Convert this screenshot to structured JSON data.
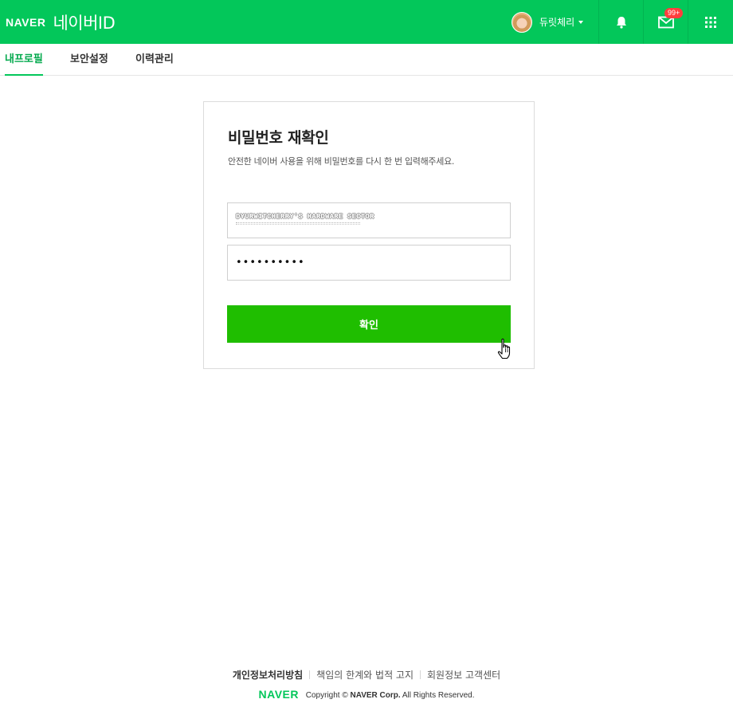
{
  "header": {
    "brand": "NAVER",
    "product": "네이버ID",
    "user_name": "듀릿체리",
    "mail_badge": "99+"
  },
  "tabs": [
    {
      "label": "내프로필",
      "active": true
    },
    {
      "label": "보안설정",
      "active": false
    },
    {
      "label": "이력관리",
      "active": false
    }
  ],
  "card": {
    "title": "비밀번호 재확인",
    "description": "안전한 네이버 사용을 위해 비밀번호를 다시 한 번 입력해주세요.",
    "id_field_watermark": "DYURWITCHERRY'S HARDWARE SECTOR",
    "password_value": "••••••••••",
    "confirm_label": "확인"
  },
  "footer": {
    "links": [
      "개인정보처리방침",
      "책임의 한계와 법적 고지",
      "회원정보 고객센터"
    ],
    "brand": "NAVER",
    "copyright_prefix": "Copyright ©",
    "copyright_corp": "NAVER Corp.",
    "copyright_suffix": "All Rights Reserved."
  },
  "colors": {
    "brand_green": "#03c75a",
    "button_green": "#1fbe00",
    "badge_red": "#ff3e3e"
  },
  "icons": [
    "avatar",
    "bell-icon",
    "mail-icon",
    "apps-grid-icon",
    "hand-pointer-cursor"
  ]
}
